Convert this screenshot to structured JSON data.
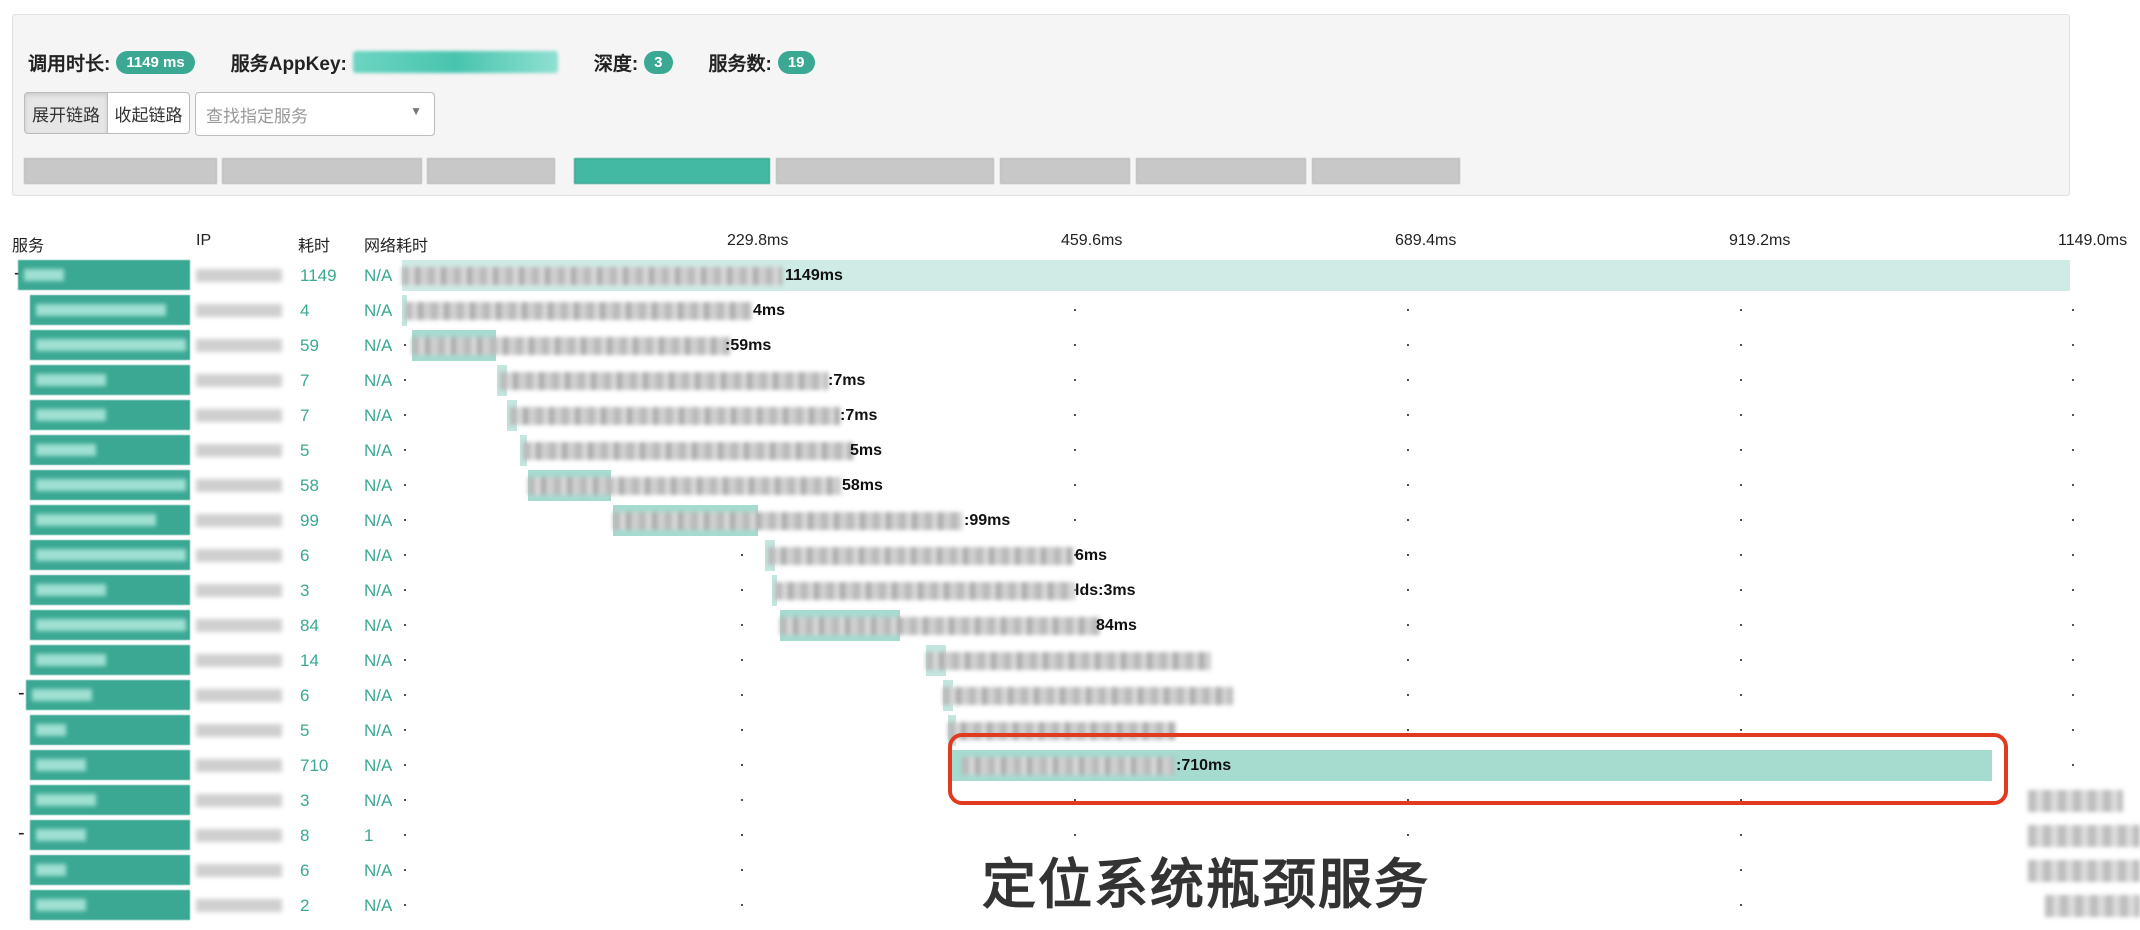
{
  "summary": {
    "duration_label": "调用时长:",
    "duration_value": "1149 ms",
    "appkey_label": "服务AppKey:",
    "depth_label": "深度:",
    "depth_value": "3",
    "service_count_label": "服务数:",
    "service_count_value": "19"
  },
  "toolbar": {
    "expand_label": "展开链路",
    "collapse_label": "收起链路",
    "search_placeholder": "查找指定服务"
  },
  "columns": {
    "service": "服务",
    "ip": "IP",
    "duration": "耗时",
    "network": "网络耗时"
  },
  "timeline": {
    "ticks": [
      "229.8ms",
      "459.6ms",
      "689.4ms",
      "919.2ms",
      "1149.0ms"
    ]
  },
  "rows": [
    {
      "toggle": "-",
      "duration": "1149",
      "network": "N/A",
      "label": "1149ms"
    },
    {
      "toggle": "",
      "duration": "4",
      "network": "N/A",
      "label": "4ms"
    },
    {
      "toggle": "",
      "duration": "59",
      "network": "N/A",
      "label": ":59ms"
    },
    {
      "toggle": "",
      "duration": "7",
      "network": "N/A",
      "label": ":7ms"
    },
    {
      "toggle": "",
      "duration": "7",
      "network": "N/A",
      "label": ":7ms"
    },
    {
      "toggle": "",
      "duration": "5",
      "network": "N/A",
      "label": "5ms"
    },
    {
      "toggle": "",
      "duration": "58",
      "network": "N/A",
      "label": "58ms"
    },
    {
      "toggle": "",
      "duration": "99",
      "network": "N/A",
      "label": ":99ms"
    },
    {
      "toggle": "",
      "duration": "6",
      "network": "N/A",
      "label": "6ms"
    },
    {
      "toggle": "",
      "duration": "3",
      "network": "N/A",
      "label": "lds:3ms"
    },
    {
      "toggle": "",
      "duration": "84",
      "network": "N/A",
      "label": "84ms"
    },
    {
      "toggle": "",
      "duration": "14",
      "network": "N/A",
      "label": ""
    },
    {
      "toggle": "-",
      "duration": "6",
      "network": "N/A",
      "label": ""
    },
    {
      "toggle": "",
      "duration": "5",
      "network": "N/A",
      "label": ""
    },
    {
      "toggle": "",
      "duration": "710",
      "network": "N/A",
      "label": ":710ms"
    },
    {
      "toggle": "",
      "duration": "3",
      "network": "N/A",
      "label": ""
    },
    {
      "toggle": "-",
      "duration": "8",
      "network": "1",
      "label": ""
    },
    {
      "toggle": "",
      "duration": "6",
      "network": "N/A",
      "label": ""
    },
    {
      "toggle": "",
      "duration": "2",
      "network": "N/A",
      "label": ""
    }
  ],
  "annotation": "定位系统瓶颈服务",
  "colors": {
    "accent": "#3aa893",
    "bar": "#c3e6df",
    "highlight": "#e03a1f"
  }
}
